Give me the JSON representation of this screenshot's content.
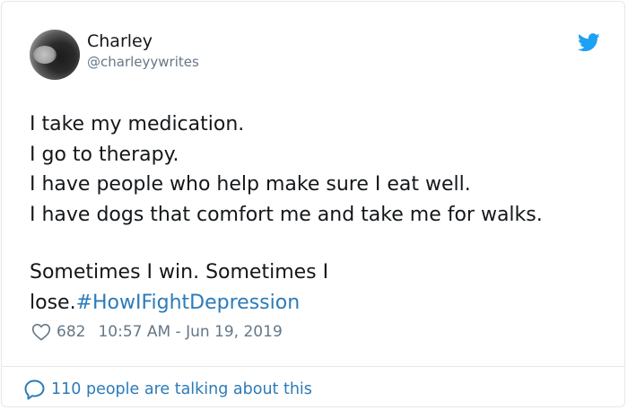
{
  "author": {
    "name": "Charley",
    "handle": "@charleyywrites"
  },
  "tweet": {
    "lines": [
      "I take my medication.",
      "I go to therapy.",
      "I have people who help make sure I eat well.",
      "I have dogs that comfort me and take me for walks."
    ],
    "line5": "Sometimes I win. Sometimes I",
    "line6_prefix": "lose.",
    "hashtag": "#HowIFightDepression"
  },
  "meta": {
    "likes": "682",
    "timestamp": "10:57 AM - Jun 19, 2019"
  },
  "footer": {
    "talking": "110 people are talking about this"
  },
  "icons": {
    "bird": "twitter-bird-icon",
    "heart": "heart-icon",
    "bubble": "speech-bubble-icon"
  },
  "colors": {
    "link": "#2b7bb9",
    "twitter_blue": "#1da1f2",
    "muted": "#657786",
    "text": "#14171a"
  }
}
